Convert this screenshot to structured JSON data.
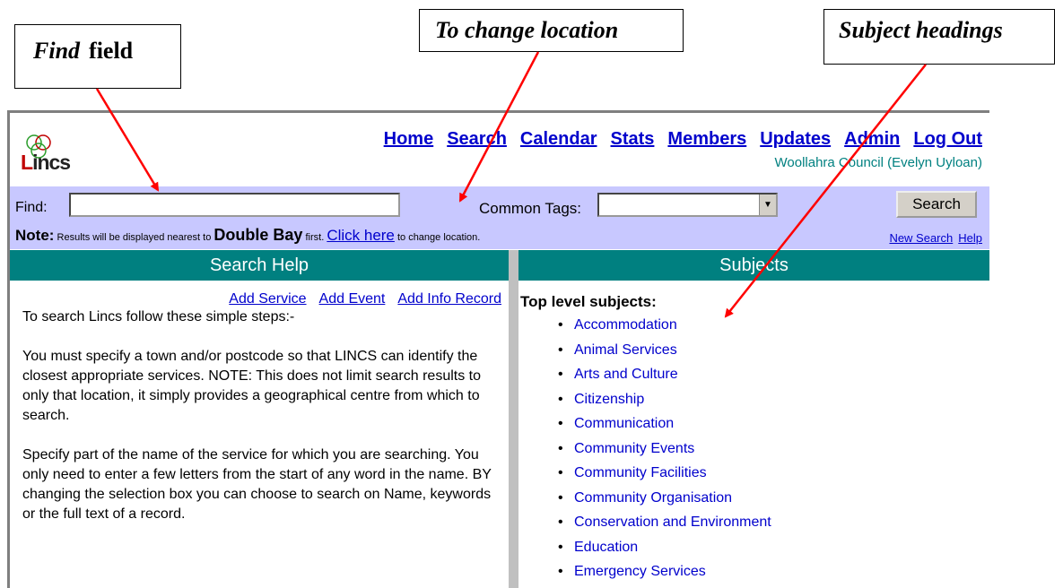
{
  "callouts": {
    "find_italic": "Find",
    "find_rest": "field",
    "location": "To change location",
    "subjects": "Subject headings"
  },
  "logo": {
    "text_l": "L",
    "text_rest": "incs"
  },
  "nav": {
    "items": [
      "Home",
      "Search",
      "Calendar",
      "Stats",
      "Members",
      "Updates",
      "Admin",
      "Log Out"
    ]
  },
  "user": "Woollahra Council  (Evelyn Uyloan)",
  "find": {
    "label": "Find:",
    "value": ""
  },
  "common_tags": {
    "label": "Common Tags:",
    "selected": ""
  },
  "search_button": "Search",
  "note": {
    "prefix_bold": "Note:",
    "text1": " Results will be displayed nearest to ",
    "location": "Double Bay",
    "text2": " first. ",
    "link": "Click here",
    "text3": " to change location."
  },
  "links": {
    "new_search": "New Search",
    "help": "Help"
  },
  "left": {
    "heading": "Search Help",
    "add_links": [
      "Add Service",
      "Add Event",
      "Add Info Record"
    ],
    "paragraphs": [
      "To search Lincs follow these simple steps:-",
      "You must specify a town and/or postcode so that LINCS can identify the closest appropriate services. NOTE: This does not limit search results to only that location, it simply provides a geographical centre from which to search.",
      "Specify part of the name of the service for which you are searching. You only need to enter a few letters from the start of any word in the name. BY changing the selection box you can choose to search on Name, keywords or the full text of a record."
    ]
  },
  "right": {
    "heading": "Subjects",
    "title": "Top level subjects:",
    "items": [
      "Accommodation",
      "Animal Services",
      "Arts and Culture",
      "Citizenship",
      "Communication",
      "Community Events",
      "Community Facilities",
      "Community Organisation",
      "Conservation and Environment",
      "Education",
      "Emergency Services"
    ]
  },
  "colors": {
    "teal": "#008080",
    "findbar": "#c8c8ff",
    "link": "#0000cc",
    "arrow": "#ff0000"
  }
}
